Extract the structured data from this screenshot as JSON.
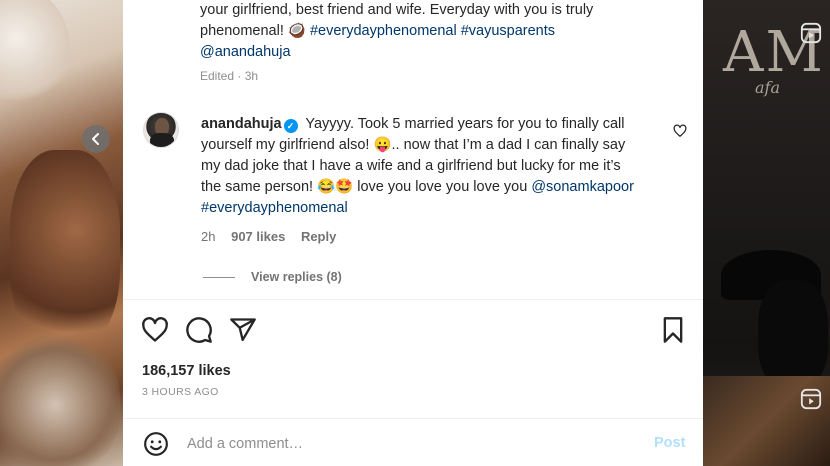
{
  "caption": {
    "line1": "your girlfriend, best friend and wife. Everyday with you is truly",
    "line2_text": "phenomenal!",
    "line2_emoji": "🥥",
    "hashtag1": "#everydayphenomenal",
    "hashtag2": "#vayusparents",
    "mention": "@anandahuja",
    "edited": "Edited · 3h"
  },
  "comment": {
    "username": "anandahuja",
    "text1": "Yayyyy. Took 5 married years for you to finally call yourself my girlfriend also!",
    "emoji1": "😛",
    "text2": ".. now that I’m a dad I can finally say my dad joke that I have a wife and a girlfriend but lucky for me it’s the same person!",
    "emoji2": "😂🤩",
    "text3": "love you love you love you",
    "mention": "@sonamkapoor",
    "hashtag": "#everydayphenomenal",
    "time": "2h",
    "likes": "907 likes",
    "reply": "Reply",
    "view_replies": "View replies (8)"
  },
  "post": {
    "likes": "186,157 likes",
    "time_ago": "3 HOURS AGO"
  },
  "add_comment": {
    "placeholder": "Add a comment…",
    "post_label": "Post"
  },
  "right_photo": {
    "magazine_text": "AM",
    "magazine_sub": "afa"
  },
  "icons": {
    "prev": "chevron-left-icon",
    "like": "heart-icon",
    "comment": "comment-icon",
    "share": "share-icon",
    "save": "bookmark-icon",
    "emoji": "emoji-icon",
    "reel": "reel-icon"
  },
  "colors": {
    "link": "#00376b",
    "verified": "#0095f6",
    "post_disabled": "#b2dffc",
    "muted": "#8e8e8e"
  }
}
